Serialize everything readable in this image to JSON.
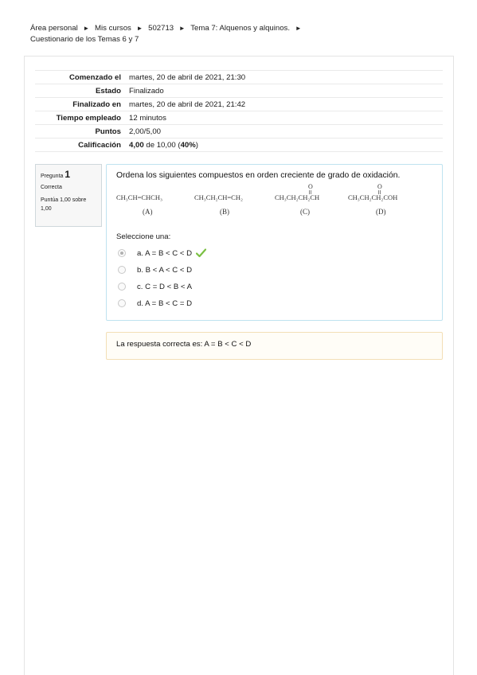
{
  "breadcrumb": {
    "items": [
      "Área personal",
      "Mis cursos",
      "502713",
      "Tema 7: Alquenos y alquinos.",
      "Cuestionario de los Temas 6 y 7"
    ],
    "separator": "►"
  },
  "summary": {
    "rows": [
      {
        "label": "Comenzado el",
        "value": "martes, 20 de abril de 2021, 21:30"
      },
      {
        "label": "Estado",
        "value": "Finalizado"
      },
      {
        "label": "Finalizado en",
        "value": "martes, 20 de abril de 2021, 21:42"
      },
      {
        "label": "Tiempo empleado",
        "value": "12 minutos"
      },
      {
        "label": "Puntos",
        "value": "2,00/5,00"
      }
    ],
    "grade": {
      "label": "Calificación",
      "score": "4,00",
      "middle": " de 10,00 (",
      "percent": "40%",
      "end": ")"
    }
  },
  "question": {
    "label": "Pregunta",
    "number": "1",
    "state": "Correcta",
    "mark": "Puntúa 1,00 sobre 1,00",
    "text": "Ordena los siguientes compuestos en orden creciente de grado de oxidación.",
    "formulas": [
      {
        "formula": "CH₃CH=CHCH₃",
        "id": "(A)"
      },
      {
        "formula": "CH₃CH₂CH=CH₂",
        "id": "(B)"
      },
      {
        "formula": "CH₃CH₂CH₂CH",
        "id": "(C)",
        "oxygen": "O"
      },
      {
        "formula": "CH₃CH₂CH₂COH",
        "id": "(D)",
        "oxygen": "O"
      }
    ],
    "select_label": "Seleccione una:",
    "options": [
      {
        "text": "a. A = B < C < D",
        "checked": true,
        "correct": true
      },
      {
        "text": "b. B < A < C < D",
        "checked": false
      },
      {
        "text": "c. C = D < B < A",
        "checked": false
      },
      {
        "text": "d. A = B < C = D",
        "checked": false
      }
    ]
  },
  "feedback": {
    "text": "La respuesta correcta es: A = B < C < D"
  },
  "colors": {
    "check_green": "#7bc043",
    "question_border": "#bfe3f0",
    "feedback_border": "#f3dfb6"
  }
}
